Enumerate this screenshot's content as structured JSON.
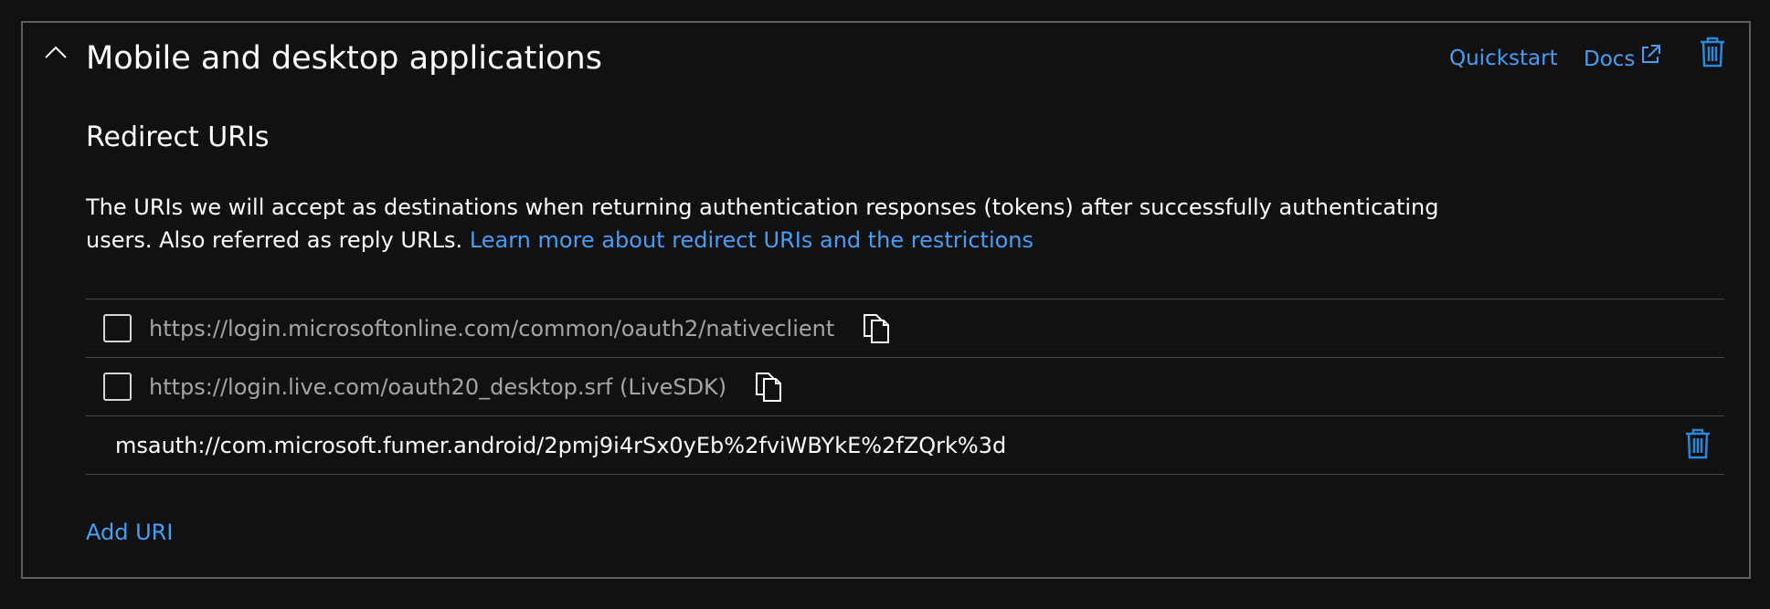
{
  "panel": {
    "title": "Mobile and desktop applications",
    "header_links": {
      "quickstart": "Quickstart",
      "docs": "Docs"
    },
    "icons": {
      "collapse": "chevron-up-icon",
      "docs_external": "external-link-icon",
      "delete": "trash-icon"
    }
  },
  "redirect_uris": {
    "title": "Redirect URIs",
    "description": "The URIs we will accept as destinations when returning authentication responses (tokens) after successfully authenticating users. Also referred as reply URLs.",
    "learn_more_link": "Learn more about redirect URIs and the restrictions",
    "suggested": [
      {
        "uri": "https://login.microsoftonline.com/common/oauth2/nativeclient",
        "checked": false,
        "icon": "copy-icon"
      },
      {
        "uri": "https://login.live.com/oauth20_desktop.srf (LiveSDK)",
        "checked": false,
        "icon": "copy-icon"
      }
    ],
    "custom": [
      {
        "uri": "msauth://com.microsoft.fumer.android/2pmj9i4rSx0yEb%2fviWBYkE%2fZQrk%3d",
        "icon": "trash-icon"
      }
    ],
    "add_uri_label": "Add URI"
  },
  "colors": {
    "background": "#111111",
    "panel_border": "#5f5f5f",
    "link": "#479ef5",
    "muted_text": "#a5a5a5",
    "icon_blue": "#2b88d8"
  }
}
